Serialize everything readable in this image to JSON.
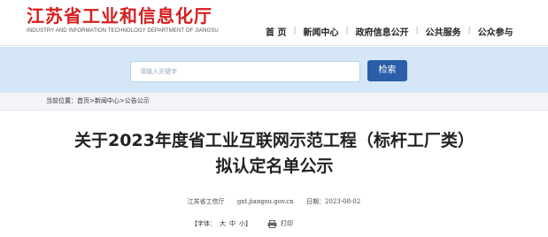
{
  "header": {
    "title": "江苏省工业和信息化厅",
    "subtitle": "INDUSTRY AND INFORMATION TECHNOLOGY DEPARTMENT OF JIANGSU",
    "brand_color": "#d61d1d",
    "nav": [
      {
        "label": "首 页"
      },
      {
        "label": "新闻中心"
      },
      {
        "label": "政府信息公开"
      },
      {
        "label": "公共服务"
      },
      {
        "label": "公众参与"
      }
    ]
  },
  "search": {
    "placeholder": "请输入关键字",
    "button_label": "检索",
    "band_color": "#d5e6f7",
    "button_color": "#2a5ea8"
  },
  "breadcrumb": {
    "prefix": "当前位置：",
    "items": [
      "首页",
      "新闻中心",
      "公告公示"
    ],
    "separator": ">"
  },
  "article": {
    "title_line1": "关于2023年度省工业互联网示范工程（标杆工厂类）",
    "title_line2": "拟认定名单公示",
    "source": "江苏省工信厅",
    "site": "gxt.jiangsu.gov.cn",
    "date_label": "日期：",
    "date": "2023-08-02"
  },
  "tools": {
    "font_label": "【字体：",
    "sizes": [
      "大",
      "中",
      "小"
    ],
    "font_close": "】",
    "print_label": "打印",
    "print_icon": "printer-icon"
  }
}
